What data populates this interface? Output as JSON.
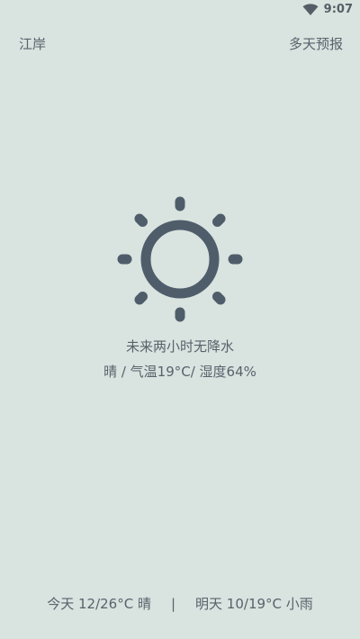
{
  "status_bar": {
    "time": "9:07",
    "wifi_icon": "wifi-icon"
  },
  "header": {
    "location": "江岸",
    "forecast_link": "多天预报"
  },
  "current": {
    "icon": "sun-icon",
    "summary": "未来两小时无降水",
    "details": "晴 / 气温19°C/ 湿度64%"
  },
  "footer": {
    "today": "今天 12/26°C 晴",
    "divider": "|",
    "tomorrow": "明天 10/19°C 小雨"
  },
  "colors": {
    "background": "#d9e3df",
    "icon": "#4f5d6b",
    "text": "#58626b"
  }
}
